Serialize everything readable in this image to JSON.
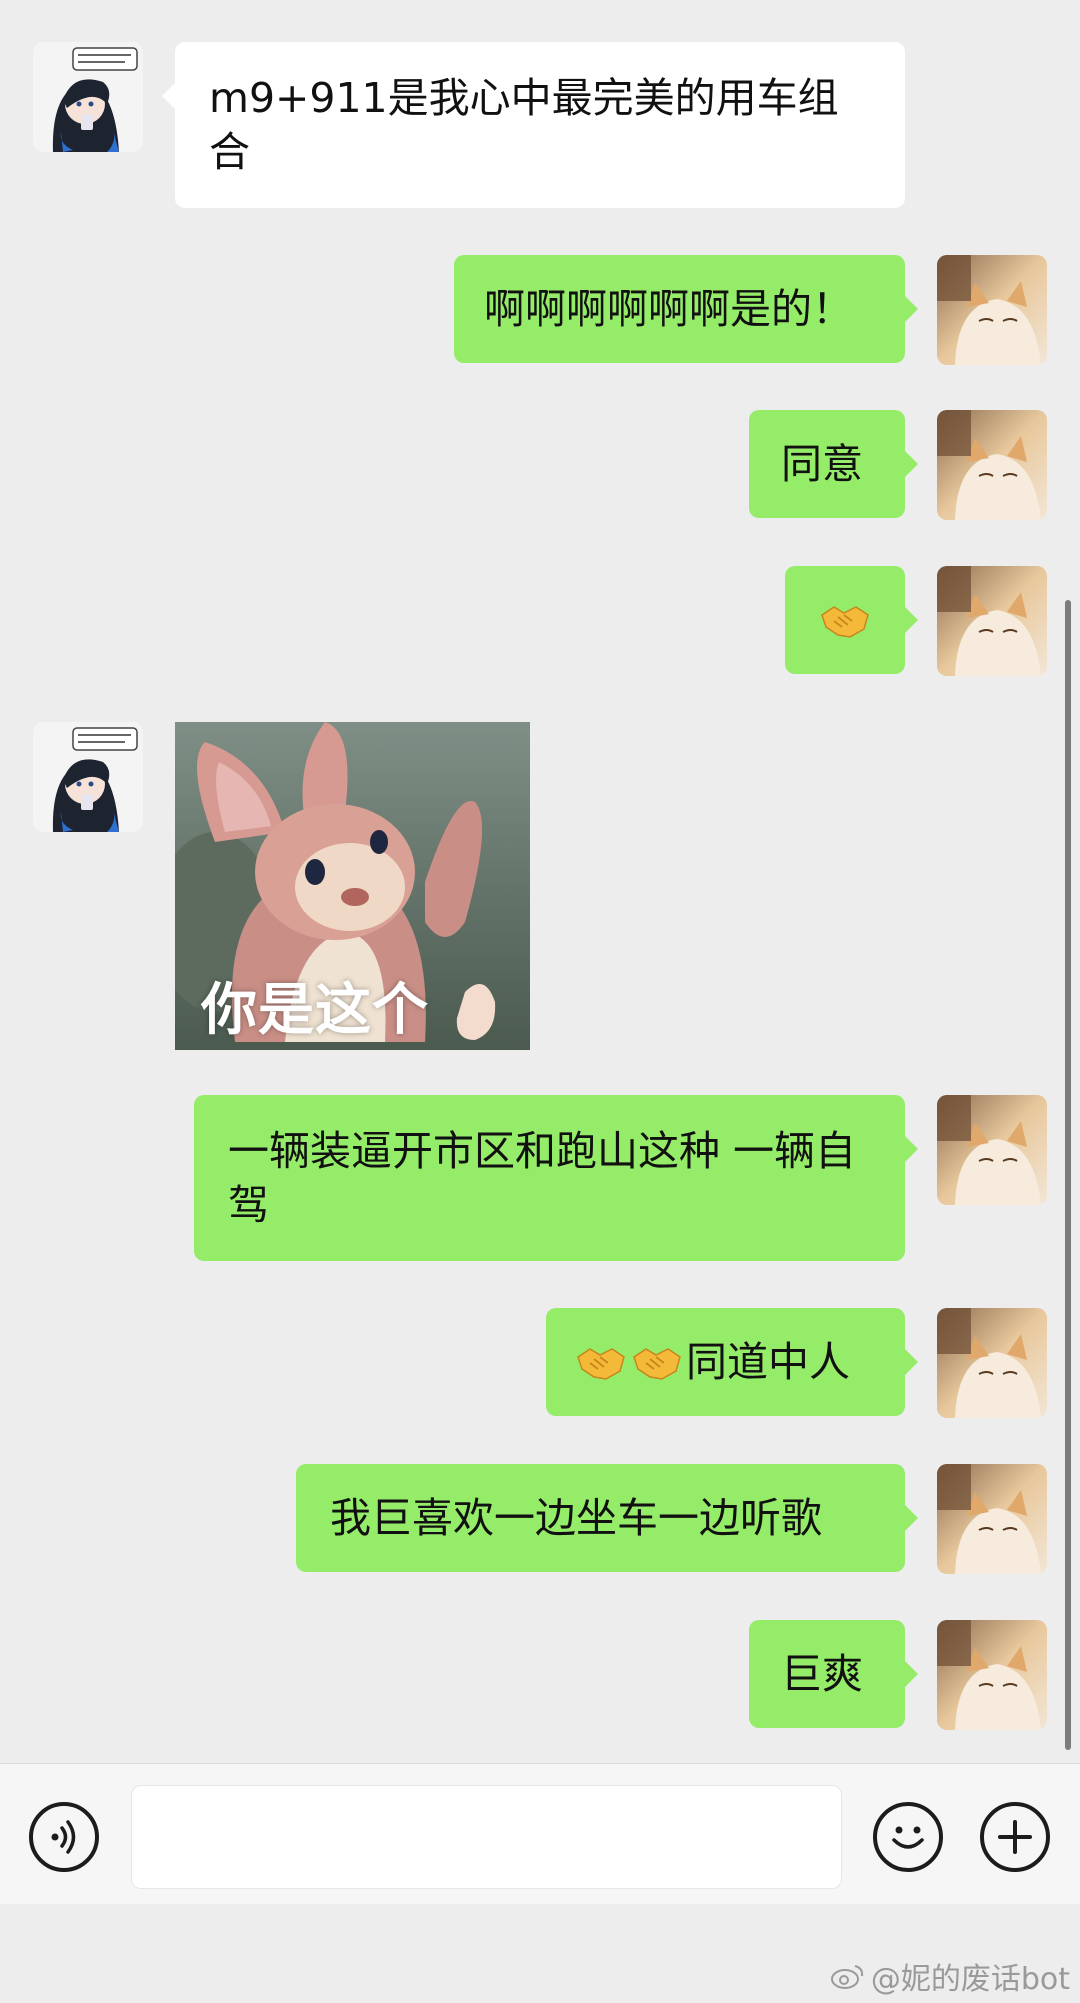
{
  "messages": [
    {
      "id": "m1",
      "side": "in",
      "text": "m9+911是我心中最完美的用车组合"
    },
    {
      "id": "m2",
      "side": "out",
      "text": "啊啊啊啊啊啊是的！"
    },
    {
      "id": "m3",
      "side": "out",
      "text": "同意"
    },
    {
      "id": "m4",
      "side": "out",
      "emoji": "handshake"
    },
    {
      "id": "m5",
      "side": "in",
      "sticker_caption": "你是这个"
    },
    {
      "id": "m6",
      "side": "out",
      "text": "一辆装逼开市区和跑山这种 一辆自驾"
    },
    {
      "id": "m7",
      "side": "out",
      "emoji": "handshake handshake",
      "text": "同道中人"
    },
    {
      "id": "m8",
      "side": "out",
      "text": "我巨喜欢一边坐车一边听歌"
    },
    {
      "id": "m9",
      "side": "out",
      "text": "巨爽"
    }
  ],
  "input": {
    "value": "",
    "placeholder": ""
  },
  "icons": {
    "voice": "voice-icon",
    "emoji": "emoji-face-icon",
    "more": "plus-icon",
    "handshake": "handshake-icon"
  },
  "colors": {
    "background": "#ededed",
    "outgoing_bubble": "#95ec69",
    "incoming_bubble": "#ffffff"
  },
  "watermark": "@妮的废话bot"
}
